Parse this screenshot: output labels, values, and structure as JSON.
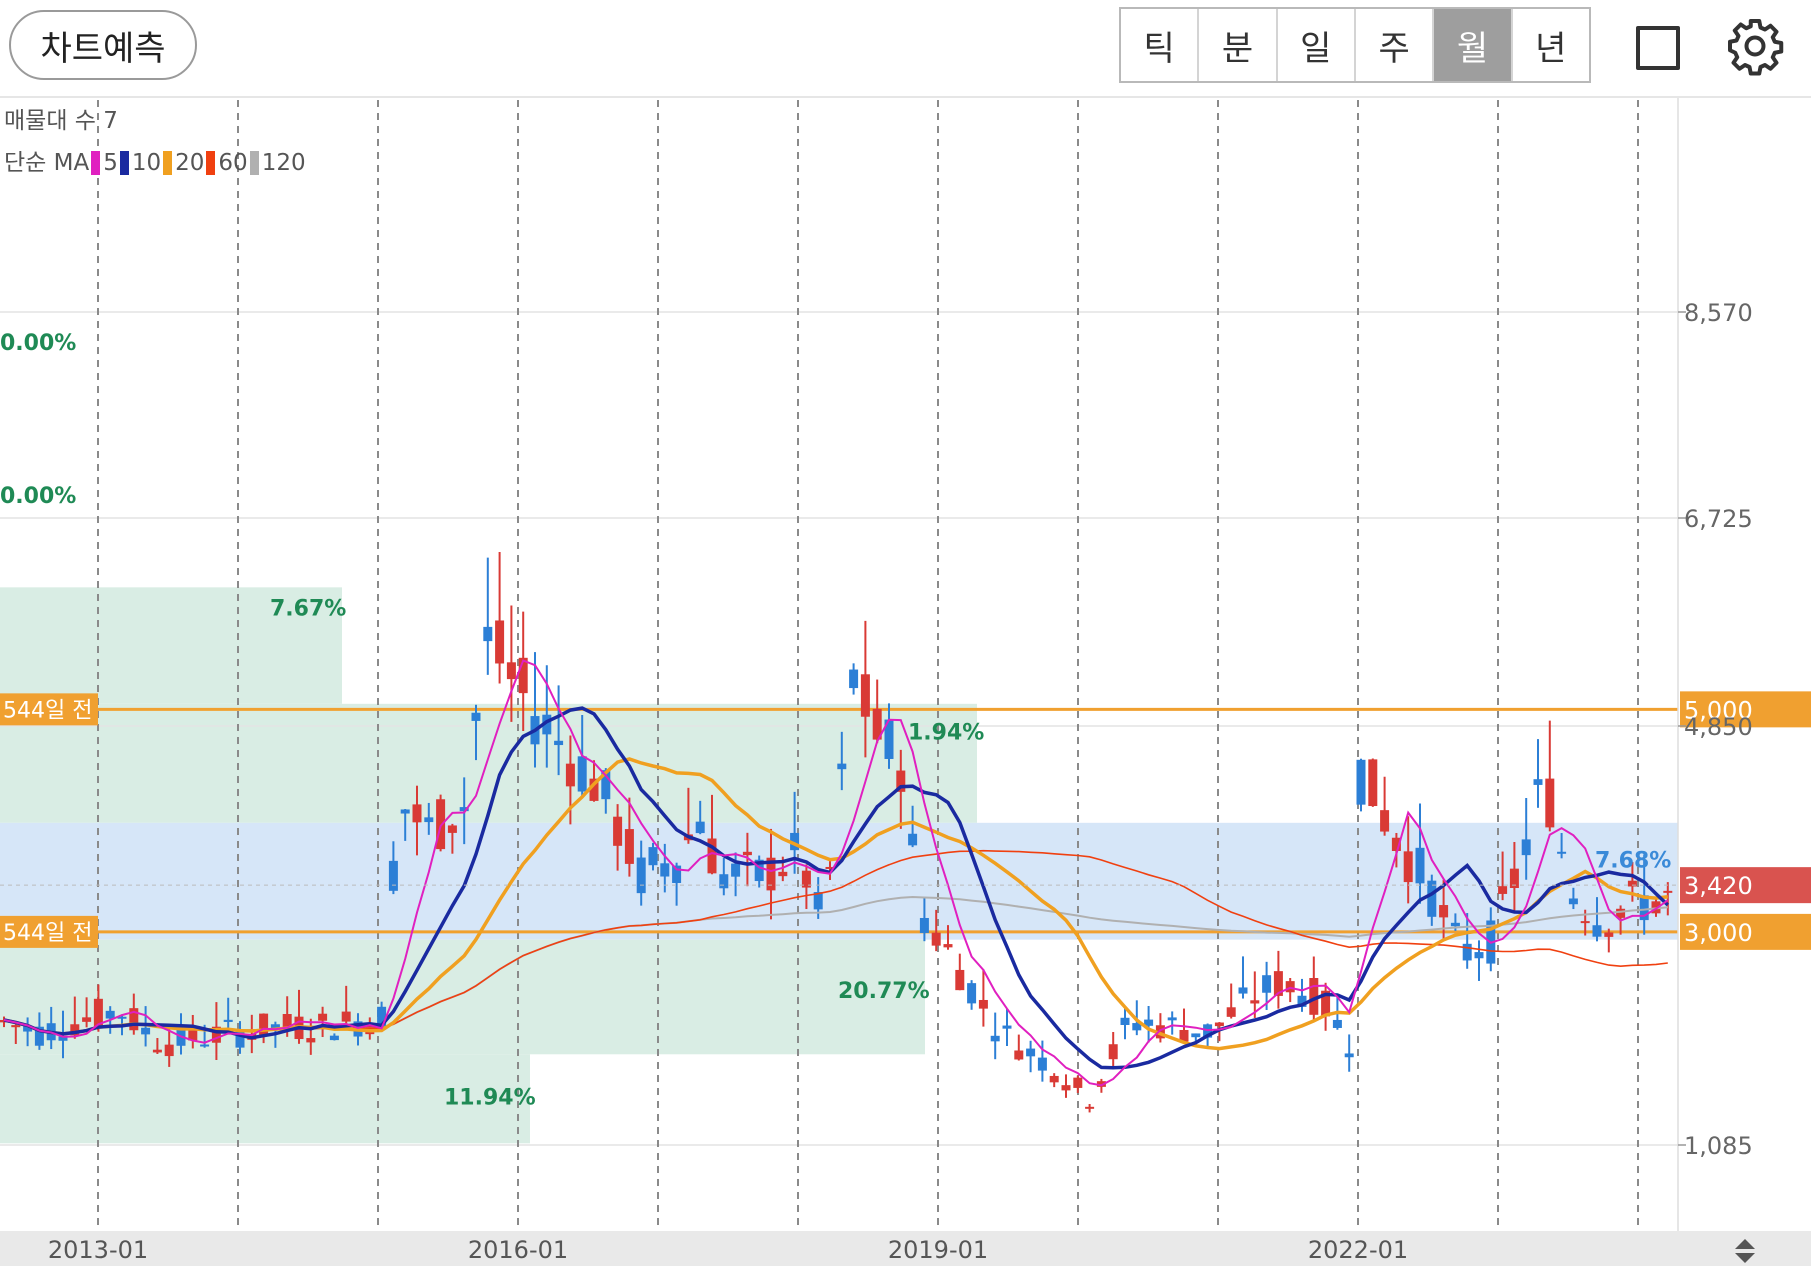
{
  "header": {
    "predict_label": "차트예측",
    "periods": [
      {
        "label": "틱",
        "active": false
      },
      {
        "label": "분",
        "active": false
      },
      {
        "label": "일",
        "active": false
      },
      {
        "label": "주",
        "active": false
      },
      {
        "label": "월",
        "active": true
      },
      {
        "label": "년",
        "active": false
      }
    ],
    "icons": {
      "square": "square-icon",
      "settings": "gear-icon"
    }
  },
  "legend": {
    "volume_profile_label": "매물대 수 7",
    "ma_label": "단순 MA",
    "ma_periods": [
      {
        "label": "5",
        "color": "#e020c0"
      },
      {
        "label": "10",
        "color": "#1a2aa0"
      },
      {
        "label": "20",
        "color": "#f0a020"
      },
      {
        "label": "60",
        "color": "#f04010"
      },
      {
        "label": "120",
        "color": "#b0b0b0"
      }
    ]
  },
  "chart_data": {
    "type": "candlestick",
    "y_axis": {
      "ticks": [
        "8,570",
        "6,725",
        "4,850",
        "1,085"
      ],
      "range": [
        700,
        8800
      ]
    },
    "x_axis": {
      "ticks": [
        "2013-01",
        "2016-01",
        "2019-01",
        "2022-01"
      ]
    },
    "price_lines": [
      {
        "label_left": "544일 전",
        "label_right": "5,000",
        "value": 5000,
        "color": "#f0a030"
      },
      {
        "label_left": "544일 전",
        "label_right": "3,000",
        "value": 3000,
        "color": "#f0a030"
      }
    ],
    "current_price": {
      "label": "3,420",
      "value": 3420,
      "color": "#d9534f"
    },
    "volume_profile": [
      {
        "label": "0.00%",
        "from": 7200,
        "to": 8300
      },
      {
        "label": "0.00%",
        "from": 6100,
        "to": 7200
      },
      {
        "label": "7.67%",
        "from": 5050,
        "to": 6100
      },
      {
        "label": "1.94%",
        "from": 3980,
        "to": 5050
      },
      {
        "label": "7.68%",
        "from": 2930,
        "to": 3980
      },
      {
        "label": "20.77%",
        "from": 1900,
        "to": 2930
      },
      {
        "label": "11.94%",
        "from": 1100,
        "to": 1900
      }
    ],
    "colors": {
      "up": "#d93a35",
      "down": "#2c7fd6"
    }
  }
}
